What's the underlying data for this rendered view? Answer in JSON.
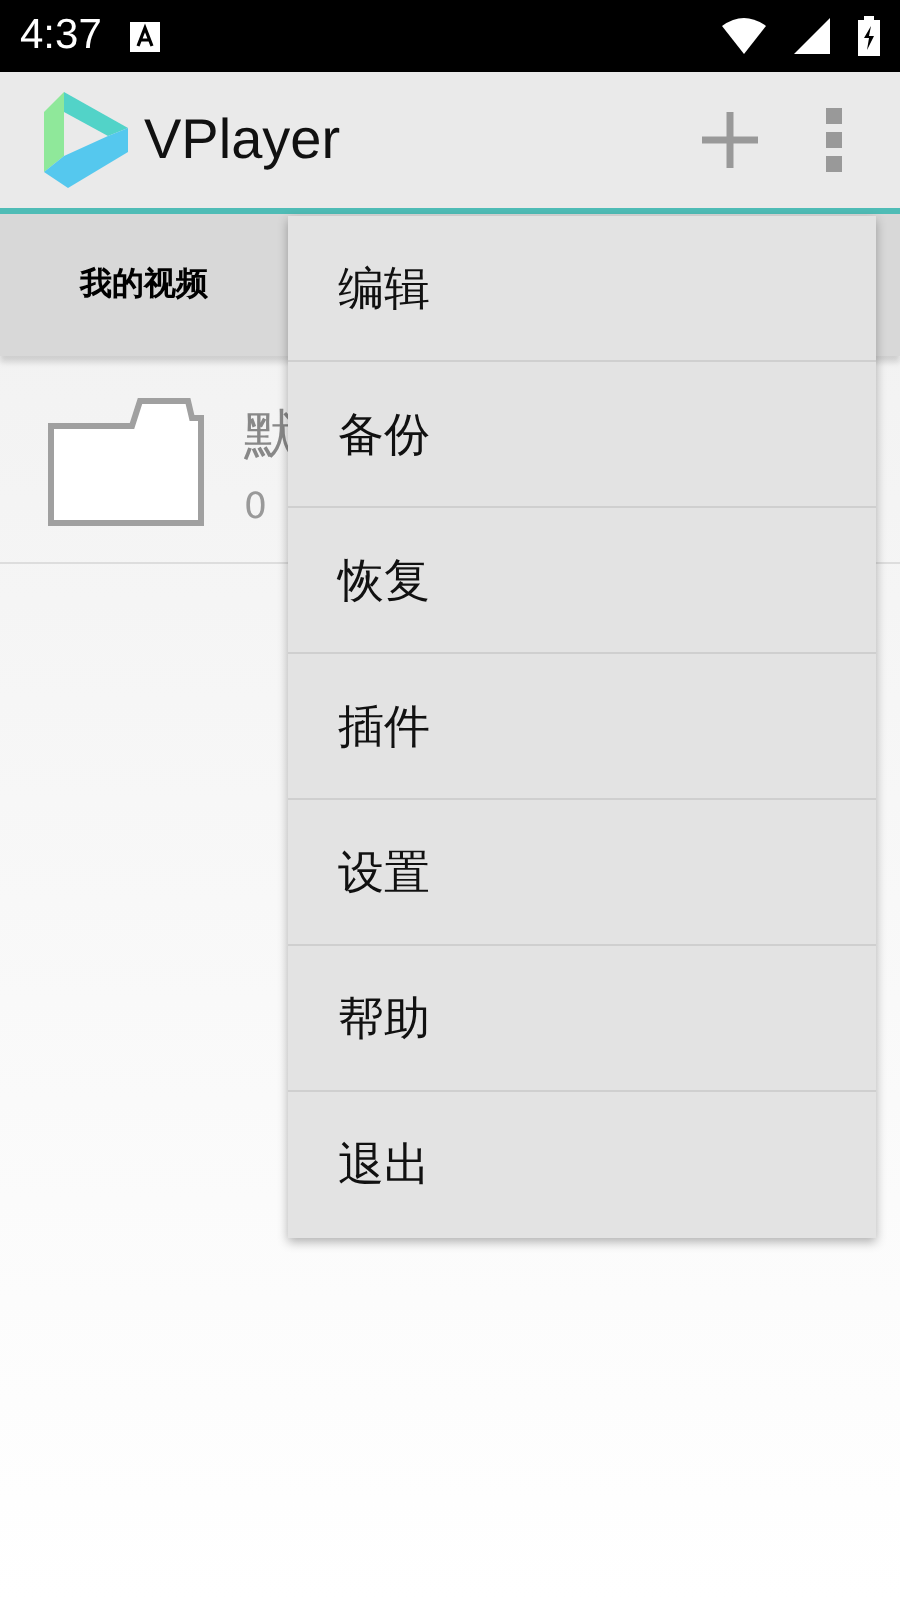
{
  "status_bar": {
    "time": "4:37"
  },
  "app_bar": {
    "title": "VPlayer"
  },
  "tabs": [
    {
      "label": "我的视频",
      "selected": true
    }
  ],
  "list": [
    {
      "kind": "folder",
      "title": "默",
      "subtitle": "0"
    }
  ],
  "menu": {
    "items": [
      "编辑",
      "备份",
      "恢复",
      "插件",
      "设置",
      "帮助",
      "退出"
    ]
  }
}
